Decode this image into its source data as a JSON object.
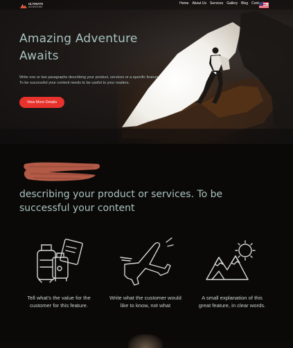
{
  "brand": {
    "name": "ULTIMATE",
    "tagline": "ADVENTURE"
  },
  "nav": {
    "items": [
      {
        "label": "Home"
      },
      {
        "label": "About Us"
      },
      {
        "label": "Services"
      },
      {
        "label": "Gallery"
      },
      {
        "label": "Blog"
      },
      {
        "label": "Contact us"
      }
    ],
    "language_icon": "us-flag-icon"
  },
  "hero": {
    "title_line1": "Amazing Adventure",
    "title_line2": "Awaits",
    "body_line1": "Write one or two paragraphs describing your product, services or a specific feature.",
    "body_line2": "To be successful your content needs to be useful to your readers.",
    "button_label": "View More Details"
  },
  "section": {
    "headline_line1": "describing your product or services.  To be",
    "headline_line2": "successful your content"
  },
  "features": [
    {
      "icon": "travel-luggage-icon",
      "text_line1": "Tell what's the value for the",
      "text_line2": "customer for this feature."
    },
    {
      "icon": "airplane-icon",
      "text_line1": "Write what the customer would",
      "text_line2": "like to know,  not what"
    },
    {
      "icon": "mountains-sun-icon",
      "text_line1": "A small explanation of this",
      "text_line2": "great  feature, in clear words."
    }
  ],
  "colors": {
    "accent": "#e8322c",
    "headline": "#a9c3bf",
    "background": "#0b0908",
    "brush": "#b85a48"
  }
}
